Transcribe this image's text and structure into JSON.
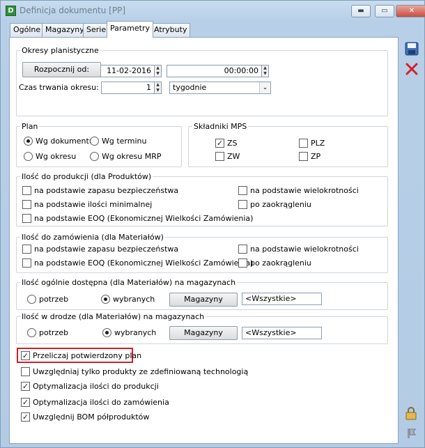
{
  "window": {
    "title": "Definicja dokumentu [PP]",
    "app_icon": "D",
    "buttons": {
      "minimize": "▬",
      "maximize": "▭",
      "close": "✕"
    }
  },
  "tabs": [
    {
      "label": "Ogólne",
      "active": false
    },
    {
      "label": "Magazyny",
      "active": false
    },
    {
      "label": "Serie",
      "active": false
    },
    {
      "label": "Parametry",
      "active": true
    },
    {
      "label": "Atrybuty",
      "active": false
    }
  ],
  "toolbar": {
    "save_icon": "save-icon",
    "delete_icon": "delete-icon",
    "lock_icon": "lock-icon",
    "pin_icon": "pin-icon"
  },
  "okresy": {
    "legend": "Okresy planistyczne",
    "start_button": "Rozpocznij od:",
    "start_date": "11-02-2016",
    "start_time": "00:00:00",
    "duration_label": "Czas trwania okresu:",
    "duration_value": "1",
    "duration_unit": "tygodnie"
  },
  "plan": {
    "legend": "Plan",
    "options": [
      {
        "label": "Wg dokumentu",
        "selected": true
      },
      {
        "label": "Wg terminu",
        "selected": false
      },
      {
        "label": "Wg okresu",
        "selected": false
      },
      {
        "label": "Wg okresu MRP",
        "selected": false
      }
    ]
  },
  "mps": {
    "legend": "Składniki MPS",
    "items": [
      {
        "label": "ZS",
        "checked": true
      },
      {
        "label": "PLZ",
        "checked": false
      },
      {
        "label": "ZW",
        "checked": false
      },
      {
        "label": "ZP",
        "checked": false
      }
    ]
  },
  "prod": {
    "legend": "Ilość do produkcji (dla Produktów)",
    "items": [
      {
        "label": "na podstawie zapasu bezpieczeństwa",
        "checked": false
      },
      {
        "label": "na podstawie ilości minimalnej",
        "checked": false
      },
      {
        "label": "na podstawie EOQ (Ekonomicznej Wielkości Zamówienia)",
        "checked": false
      },
      {
        "label": "na podstawie wielokrotności",
        "checked": false
      },
      {
        "label": "po zaokrągleniu",
        "checked": false
      }
    ]
  },
  "zam": {
    "legend": "Ilość do zamówienia (dla Materiałów)",
    "items": [
      {
        "label": "na podstawie zapasu bezpieczeństwa",
        "checked": false
      },
      {
        "label": "na podstawie EOQ (Ekonomicznej Wielkości Zamówienia)",
        "checked": false
      },
      {
        "label": "na podstawie wielokrotności",
        "checked": false
      },
      {
        "label": "po zaokrągleniu",
        "checked": false
      }
    ]
  },
  "dost": {
    "legend": "Ilość ogólnie dostępna (dla Materiałów) na magazynach",
    "opt_potrzeb": "potrzeb",
    "opt_wybranych": "wybranych",
    "selected": "wybranych",
    "button": "Magazyny",
    "value": "<Wszystkie>"
  },
  "drodze": {
    "legend": "Ilość w drodze (dla Materiałów) na magazynach",
    "opt_potrzeb": "potrzeb",
    "opt_wybranych": "wybranych",
    "selected": "wybranych",
    "button": "Magazyny",
    "value": "<Wszystkie>"
  },
  "options": [
    {
      "label": "Przeliczaj potwierdzony plan",
      "checked": true,
      "highlighted": true
    },
    {
      "label": "Uwzględniaj tylko produkty ze zdefiniowaną technologią",
      "checked": false
    },
    {
      "label": "Optymalizacja ilości do produkcji",
      "checked": true
    },
    {
      "label": "Optymalizacja ilości do zamówienia",
      "checked": true
    },
    {
      "label": "Uwzględnij BOM półproduktów",
      "checked": true
    }
  ],
  "colors": {
    "highlight": "#d22027",
    "delete": "#d3202a",
    "save": "#2f5f9e"
  }
}
